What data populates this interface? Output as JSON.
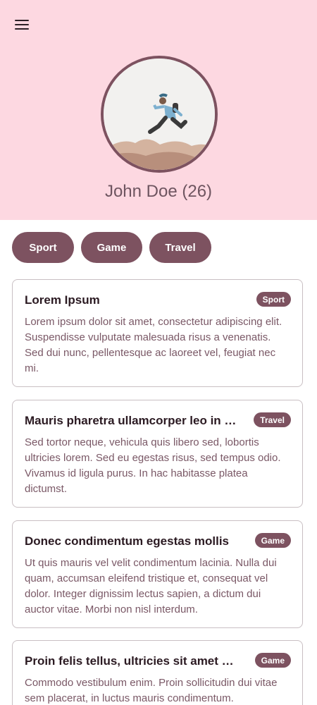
{
  "header": {
    "menu_icon": "hamburger-menu-icon",
    "avatar_image": "person-jumping-photo",
    "profile_name": "John Doe (26)",
    "background_color": "#fdd8e1",
    "accent_color": "#7d5260"
  },
  "filters": [
    {
      "label": "Sport"
    },
    {
      "label": "Game"
    },
    {
      "label": "Travel"
    }
  ],
  "cards": [
    {
      "title": "Lorem Ipsum",
      "tag": "Sport",
      "body": "Lorem ipsum dolor sit amet, consectetur adipiscing elit. Suspendisse vulputate malesuada risus a venenatis. Sed dui nunc, pellentesque ac laoreet vel, feugiat nec mi."
    },
    {
      "title": "Mauris pharetra ullamcorper leo in aliquet",
      "tag": "Travel",
      "body": "Sed tortor neque, vehicula quis libero sed, lobortis ultricies lorem. Sed eu egestas risus, sed tempus odio. Vivamus id ligula purus. In hac habitasse platea dictumst."
    },
    {
      "title": "Donec condimentum egestas mollis",
      "tag": "Game",
      "body": "Ut quis mauris vel velit condimentum lacinia. Nulla dui quam, accumsan eleifend tristique et, consequat vel dolor. Integer dignissim lectus sapien, a dictum dui auctor vitae. Morbi non nisl interdum."
    },
    {
      "title": "Proin felis tellus, ultricies sit amet porttitor",
      "tag": "Game",
      "body": "Commodo vestibulum enim. Proin sollicitudin dui vitae sem placerat, in luctus mauris condimentum."
    }
  ]
}
